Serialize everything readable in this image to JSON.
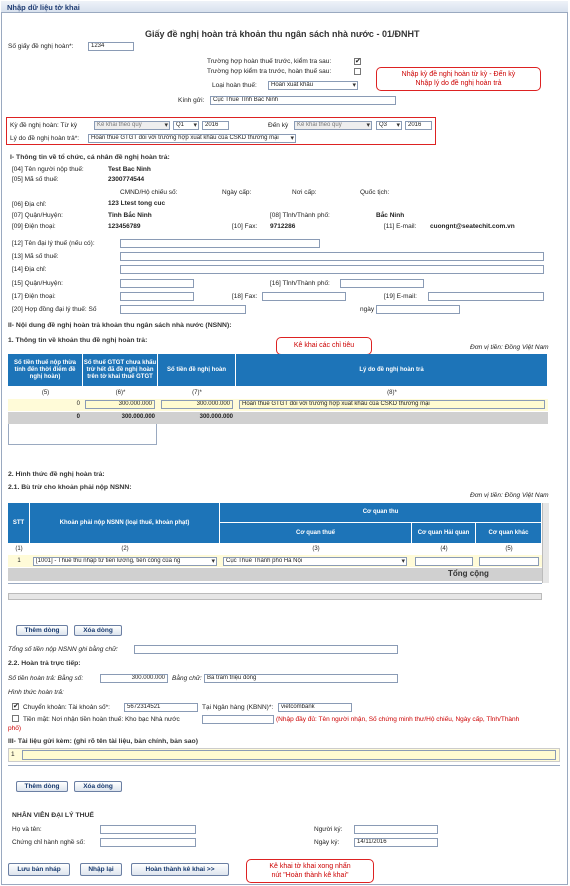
{
  "window": {
    "title": "Nhập dữ liệu tờ khai"
  },
  "form": {
    "title": "Giấy đề nghị hoàn trả khoản thu ngân sách nhà nước - 01/ĐNHT",
    "so_giay_label": "Số giấy đề nghị hoàn*:",
    "so_giay_value": "1234",
    "opt1_label": "Trường hợp hoàn thuế trước, kiểm tra sau:",
    "opt1_checked": "✔",
    "opt2_label": "Trường hợp kiểm tra trước, hoàn thuế sau:",
    "loai_hoan_label": "Loại hoàn thuế:",
    "loai_hoan_value": "Hoàn xuất khẩu",
    "kinh_gui_label": "Kính gửi:",
    "kinh_gui_value": "Cục Thuế Tỉnh Bắc Ninh",
    "ky_tu_label": "Kỳ đề nghị hoàn: Từ kỳ",
    "ky_tu_type": "Kê khai theo quý",
    "ky_tu_q": "Q1",
    "ky_tu_year": "2016",
    "den_ky_label": "Đến kỳ",
    "den_ky_type": "Kê khai theo quý",
    "den_ky_q": "Q3",
    "den_ky_year": "2016",
    "ly_do_label": "Lý do đề nghị hoàn trả*:",
    "ly_do_value": "Hoàn thuế GTGT đối với trường hợp xuất khẩu của CSKD thương mại"
  },
  "callouts": {
    "c1": "Nhập kỳ đề nghị hoàn từ kỳ - Đến kỳ\nNhập lý do đề nghị hoàn trả",
    "c2": "Kê khai các chỉ tiêu",
    "c3": "Kê khai tờ khai xong nhấn\nnút \"Hoàn thành kê khai\""
  },
  "section1": {
    "heading": "I- Thông tin về tổ chức, cá nhân đề nghị hoàn trả:",
    "l04": "[04] Tên người nộp thuế:",
    "v04": "Test Bac Ninh",
    "l05": "[05] Mã số thuế:",
    "v05": "2300774544",
    "cmnd": "CMND/Hộ chiếu số:",
    "ngay_cap": "Ngày cấp:",
    "noi_cap": "Nơi cấp:",
    "quoc_tich": "Quốc tịch:",
    "l06": "[06] Địa chỉ:",
    "v06": "123 Ltest tong cuc",
    "l07": "[07] Quận/Huyện:",
    "v07": "Tỉnh Bắc Ninh",
    "l08": "[08] Tỉnh/Thành phố:",
    "v08": "Bắc Ninh",
    "l09": "[09] Điện thoại:",
    "v09": "123456789",
    "l10": "[10] Fax:",
    "v10": "9712286",
    "l11": "[11] E-mail:",
    "v11": "cuongnt@seatechit.com.vn",
    "l12": "[12] Tên đại lý thuế (nếu có):",
    "l13": "[13] Mã số thuế:",
    "l14": "[14] Địa chỉ:",
    "l15": "[15] Quận/Huyện:",
    "l16": "[16] Tỉnh/Thành phố:",
    "l17": "[17] Điện thoại:",
    "l18": "[18] Fax:",
    "l19": "[19] E-mail:",
    "l20": "[20] Hợp đồng đại lý thuế: Số",
    "ngay": "ngày"
  },
  "section2": {
    "heading": "II- Nội dung đề nghị hoàn trả khoản thu ngân sách nhà nước (NSNN):",
    "sub1": "1. Thông tin về khoản thu đề nghị hoàn trả:",
    "unit": "Đơn vị tiền: Đồng Việt Nam",
    "table1": {
      "h1": "Số tiền thuế nộp thừa tính đến thời điểm đề nghị hoàn)",
      "h2": "Số thuế GTGT chưa khấu trừ hết đã đề nghị hoàn trên tờ khai thuế GTGT",
      "h3": "Số tiền đề nghị hoàn",
      "h4": "Lý do đề nghị hoàn trả",
      "n1": "(5)",
      "n2": "(6)*",
      "n3": "(7)*",
      "n4": "(8)*",
      "r_v1": "0",
      "r_v2": "300.000.000",
      "r_v3": "300.000.000",
      "r_v4": "Hoàn thuế GTGT đối với trường hợp xuất khẩu của CSKD thương mại",
      "t_v1": "0",
      "t_v2": "300.000.000",
      "t_v3": "300.000.000"
    },
    "sub2": "2. Hình thức đề nghị hoàn trả:",
    "sub21": "2.1. Bù trừ cho khoản phải nộp NSNN:",
    "unit2": "Đơn vị tiền: Đồng Việt Nam",
    "table2": {
      "stt": "STT",
      "khoan": "Khoản phải nộp NSNN (loại thuế, khoản phạt)",
      "co_quan_thu": "Cơ quan thu",
      "cq_thue": "Cơ quan thuế",
      "cq_hq": "Cơ quan Hải quan",
      "cq_khac": "Cơ quan khác",
      "n1": "(1)",
      "n2": "(2)",
      "n3": "(3)",
      "n4": "(4)",
      "n5": "(5)",
      "r_stt": "1",
      "r_khoan": "[1001] - Thuế thu nhập từ tiền lương, tiền công của ng",
      "r_cq": "Cục Thuế Thành phố Hà Nội",
      "tong": "Tổng cộng"
    },
    "btn_add": "Thêm dòng",
    "btn_del": "Xóa dòng",
    "tong_bang_chu": "Tổng số tiền nộp NSNN ghi bằng chữ:",
    "sub22": "2.2. Hoàn trả trực tiếp:",
    "so_tien_label": "Số tiền hoàn trả: Bằng số:",
    "so_tien_value": "300.000.000",
    "bang_chu_label": "Bằng chữ:",
    "bang_chu_value": "Ba trăm triệu đồng",
    "hinh_thuc": "Hình thức hoàn trả:",
    "ck_label": "Chuyển khoản: Tài khoản số*:",
    "ck_checked": "✔",
    "tk_value": "5672314521",
    "ngan_hang_label": "Tại Ngân hàng (KBNN)*:",
    "ngan_hang_value": "vietcombank",
    "tien_mat_label": "Tiền mặt: Nơi nhận tiền hoàn thuế: Kho bạc Nhà nước",
    "tien_mat_note": "(Nhập đầy đủ: Tên người nhận, Số chứng minh thư/Hộ chiếu, Ngày cấp, Tỉnh/Thành",
    "tien_mat_note2": "phố)"
  },
  "section3": {
    "heading": "III- Tài liệu gửi kèm: (ghi rõ tên tài liệu, bản chính, bản sao)",
    "row_no": "1",
    "btn_add": "Thêm dòng",
    "btn_del": "Xóa dòng"
  },
  "agent": {
    "heading": "NHÂN VIÊN ĐẠI LÝ THUẾ",
    "ho_ten": "Họ và tên:",
    "cchn": "Chứng chỉ hành nghề số:",
    "nguoi_ky": "Người ký:",
    "ngay_ky": "Ngày ký:",
    "ngay_ky_value": "14/11/2016"
  },
  "footer": {
    "btn_save": "Lưu bản nháp",
    "btn_reset": "Nhập lại",
    "btn_finish": "Hoàn thành kê khai >>"
  },
  "colors": {
    "table_header": "#1d74b8",
    "callout": "#d22222",
    "header_text": "#1f3c72"
  }
}
